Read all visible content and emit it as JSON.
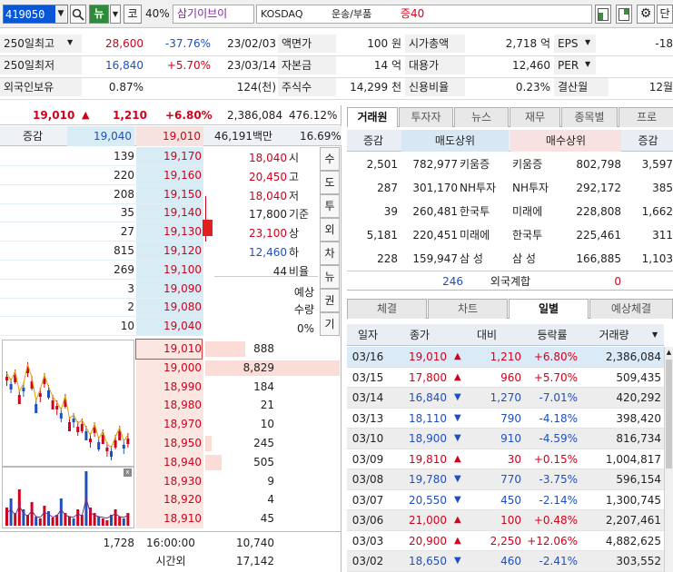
{
  "toolbar": {
    "code": "419050",
    "news_btn": "뉴",
    "market_btn": "코",
    "margin_pct": "40%",
    "stock_name": "삼기이브이",
    "market": "KOSDAQ",
    "sector": "운송/부품",
    "margin_tag": "증40",
    "extra_btn": "단"
  },
  "info": {
    "rows": [
      {
        "l1": "250일최고",
        "v1": "28,600",
        "p1": "-37.76%",
        "d1": "23/02/03",
        "l2": "액면가",
        "v2": "100 원",
        "l3": "시가총액",
        "v3": "2,718 억",
        "l4": "EPS",
        "v4": "-18"
      },
      {
        "l1": "250일최저",
        "v1": "16,840",
        "p1": "+5.70%",
        "d1": "23/03/14",
        "l2": "자본금",
        "v2": "14 억",
        "l3": "대용가",
        "v3": "12,460",
        "l4": "PER",
        "v4": ""
      },
      {
        "l1": "외국인보유",
        "v1": "0.87%",
        "p1": "",
        "d1": "124(천)",
        "l2": "주식수",
        "v2": "14,299 천",
        "l3": "신용비율",
        "v3": "0.23%",
        "l4": "결산월",
        "v4": "12월"
      }
    ]
  },
  "quote": {
    "price": "19,010",
    "change": "1,210",
    "rate": "+6.80%",
    "volume": "2,386,084",
    "turnover": "476.12%",
    "label": "증감",
    "ref1": "19,040",
    "ref2": "19,010",
    "amount": "46,191백만",
    "pct": "16.69%"
  },
  "orderbook": {
    "asks": [
      {
        "qty": "139",
        "price": "19,170"
      },
      {
        "qty": "220",
        "price": "19,160"
      },
      {
        "qty": "208",
        "price": "19,150"
      },
      {
        "qty": "35",
        "price": "19,140"
      },
      {
        "qty": "27",
        "price": "19,130"
      },
      {
        "qty": "815",
        "price": "19,120"
      },
      {
        "qty": "269",
        "price": "19,100"
      },
      {
        "qty": "3",
        "price": "19,090"
      },
      {
        "qty": "2",
        "price": "19,080"
      },
      {
        "qty": "10",
        "price": "19,040"
      }
    ],
    "bids": [
      {
        "price": "19,010",
        "qty": "888"
      },
      {
        "price": "19,000",
        "qty": "8,829"
      },
      {
        "price": "18,990",
        "qty": "184"
      },
      {
        "price": "18,980",
        "qty": "21"
      },
      {
        "price": "18,970",
        "qty": "10"
      },
      {
        "price": "18,950",
        "qty": "245"
      },
      {
        "price": "18,940",
        "qty": "505"
      },
      {
        "price": "18,930",
        "qty": "9"
      },
      {
        "price": "18,920",
        "qty": "4"
      },
      {
        "price": "18,910",
        "qty": "45"
      }
    ],
    "side": [
      {
        "val": "18,040",
        "lbl": "시"
      },
      {
        "val": "20,450",
        "lbl": "고"
      },
      {
        "val": "18,040",
        "lbl": "저"
      },
      {
        "val": "17,800",
        "lbl": "기준"
      },
      {
        "val": "23,100",
        "lbl": "상"
      },
      {
        "val": "12,460",
        "lbl": "하"
      },
      {
        "val": "44",
        "lbl": "비율"
      }
    ],
    "expect_lbl1": "예상",
    "expect_lbl2": "수량",
    "expect_pct": "0%",
    "vtabs": [
      "수",
      "도",
      "투",
      "외",
      "차",
      "뉴",
      "권",
      "기"
    ],
    "total_ask": "1,728",
    "time": "16:00:00",
    "total_bid": "10,740",
    "after_lbl": "시간외",
    "after_val": "17,142"
  },
  "broker": {
    "tabs": [
      "거래원",
      "투자자",
      "뉴스",
      "재무",
      "종목별",
      "프로"
    ],
    "h_change": "증감",
    "h_sell": "매도상위",
    "h_buy": "매수상위",
    "h_change2": "증감",
    "rows": [
      {
        "c1": "2,501",
        "sv": "782,977",
        "sn": "키움증",
        "bn": "키움증",
        "bv": "802,798",
        "c2": "3,597"
      },
      {
        "c1": "287",
        "sv": "301,170",
        "sn": "NH투자",
        "bn": "NH투자",
        "bv": "292,172",
        "c2": "385"
      },
      {
        "c1": "39",
        "sv": "260,481",
        "sn": "한국투",
        "bn": "미래에",
        "bv": "228,808",
        "c2": "1,662"
      },
      {
        "c1": "5,181",
        "sv": "220,451",
        "sn": "미래에",
        "bn": "한국투",
        "bv": "225,461",
        "c2": "311"
      },
      {
        "c1": "228",
        "sv": "159,947",
        "sn": "삼 성",
        "bn": "삼 성",
        "bv": "166,885",
        "c2": "1,103"
      }
    ],
    "foreign_sell": "246",
    "foreign_lbl": "외국계합",
    "foreign_buy": "0"
  },
  "daily": {
    "tabs": [
      "체결",
      "차트",
      "일별",
      "예상체결"
    ],
    "headers": [
      "일자",
      "종가",
      "대비",
      "등락률",
      "거래량"
    ],
    "rows": [
      {
        "date": "03/16",
        "close": "19,010",
        "dir": "up",
        "diff": "1,210",
        "rate": "+6.80%",
        "vol": "2,386,084"
      },
      {
        "date": "03/15",
        "close": "17,800",
        "dir": "up",
        "diff": "960",
        "rate": "+5.70%",
        "vol": "509,435"
      },
      {
        "date": "03/14",
        "close": "16,840",
        "dir": "down",
        "diff": "1,270",
        "rate": "-7.01%",
        "vol": "420,292"
      },
      {
        "date": "03/13",
        "close": "18,110",
        "dir": "down",
        "diff": "790",
        "rate": "-4.18%",
        "vol": "398,420"
      },
      {
        "date": "03/10",
        "close": "18,900",
        "dir": "down",
        "diff": "910",
        "rate": "-4.59%",
        "vol": "816,734"
      },
      {
        "date": "03/09",
        "close": "19,810",
        "dir": "up",
        "diff": "30",
        "rate": "+0.15%",
        "vol": "1,004,817"
      },
      {
        "date": "03/08",
        "close": "19,780",
        "dir": "down",
        "diff": "770",
        "rate": "-3.75%",
        "vol": "596,154"
      },
      {
        "date": "03/07",
        "close": "20,550",
        "dir": "down",
        "diff": "450",
        "rate": "-2.14%",
        "vol": "1,300,745"
      },
      {
        "date": "03/06",
        "close": "21,000",
        "dir": "up",
        "diff": "100",
        "rate": "+0.48%",
        "vol": "2,207,461"
      },
      {
        "date": "03/03",
        "close": "20,900",
        "dir": "up",
        "diff": "2,250",
        "rate": "+12.06%",
        "vol": "4,882,625"
      },
      {
        "date": "03/02",
        "close": "18,650",
        "dir": "down",
        "diff": "460",
        "rate": "-2.41%",
        "vol": "303,552"
      }
    ]
  },
  "colors": {
    "up": "#d0021b",
    "down": "#1f4fbf",
    "ask_bg": "#d8ecf6",
    "bid_bg": "#fbe6e2"
  }
}
